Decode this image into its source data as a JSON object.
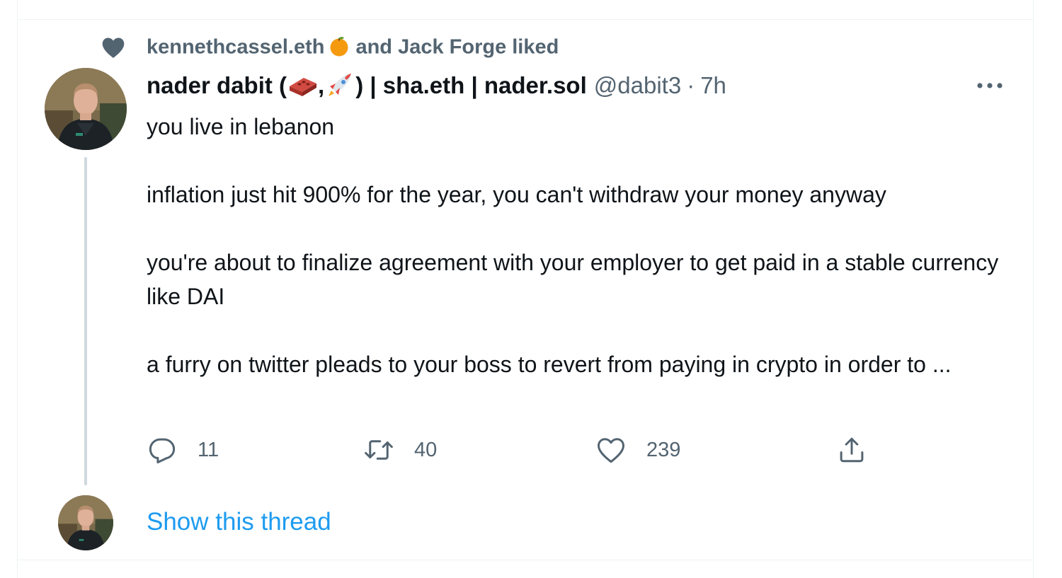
{
  "social_context": {
    "user1": "kennethcassel.eth",
    "user1_emoji": "orange-emoji",
    "suffix": "and Jack Forge liked"
  },
  "author": {
    "name_part1": "nader dabit (",
    "name_sep": ",",
    "name_part2": ") | sha.eth | nader.sol",
    "handle": "@dabit3",
    "separator": "·",
    "time": "7h",
    "emojis": [
      "brick-emoji",
      "rocket-emoji"
    ]
  },
  "tweet": {
    "paragraphs": [
      "you live in lebanon",
      "inflation just hit 900% for the year, you can't withdraw your money anyway",
      "you're about to finalize agreement with your employer to get paid in a stable currency like DAI",
      "a furry on twitter pleads to your boss to revert from paying in crypto in order to ..."
    ]
  },
  "actions": {
    "replies": "11",
    "retweets": "40",
    "likes": "239"
  },
  "thread": {
    "show_label": "Show this thread"
  },
  "colors": {
    "text_primary": "#0f1419",
    "text_secondary": "#536471",
    "link": "#1d9bf0",
    "thread_line": "#cfd9de",
    "divider": "#eff3f4"
  }
}
